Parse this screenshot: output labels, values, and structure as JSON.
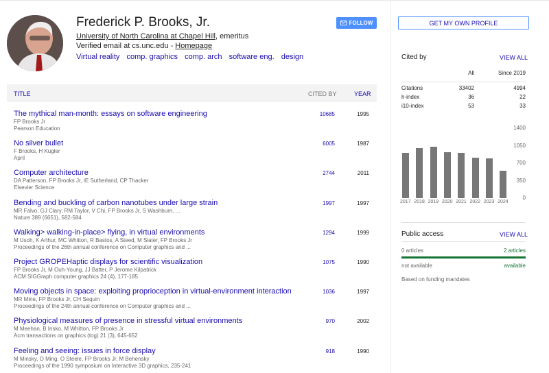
{
  "profile": {
    "name": "Frederick P. Brooks, Jr.",
    "affiliation_link": "University of North Carolina at Chapel Hill",
    "affiliation_suffix": ", emeritus",
    "verified": "Verified email at cs.unc.edu - ",
    "homepage": "Homepage",
    "interests": [
      "Virtual reality",
      "comp. graphics",
      "comp. arch",
      "software eng.",
      "design"
    ],
    "follow_label": "FOLLOW",
    "my_profile_label": "GET MY OWN PROFILE"
  },
  "table": {
    "headers": {
      "title": "TITLE",
      "cited_by": "CITED BY",
      "year": "YEAR"
    },
    "rows": [
      {
        "title": "The mythical man-month: essays on software engineering",
        "authors": "FP Brooks Jr",
        "pub": "Pearson Education",
        "cited": "10685",
        "year": "1995"
      },
      {
        "title": "No silver bullet",
        "authors": "F Brooks, H Kugler",
        "pub": "April",
        "cited": "6005",
        "year": "1987"
      },
      {
        "title": "Computer architecture",
        "authors": "DA Patterson, FP Brooks Jr, IE Sutherland, CP Thacker",
        "pub": "Elsevier Science",
        "cited": "2744",
        "year": "2011"
      },
      {
        "title": "Bending and buckling of carbon nanotubes under large strain",
        "authors": "MR Falvo, GJ Clary, RM Taylor, V Chi, FP Brooks Jr, S Washburn, ...",
        "pub": "Nature 389 (6651), 582-584",
        "cited": "1997",
        "year": "1997"
      },
      {
        "title": "Walking> walking-in-place> flying, in virtual environments",
        "authors": "M Usoh, K Arthur, MC Whitton, R Bastos, A Steed, M Slater, FP Brooks Jr",
        "pub": "Proceedings of the 26th annual conference on Computer graphics and ...",
        "cited": "1294",
        "year": "1999"
      },
      {
        "title": "Project GROPEHaptic displays for scientific visualization",
        "authors": "FP Brooks Jr, M Ouh-Young, JJ Batter, P Jerome Kilpatrick",
        "pub": "ACM SIGGraph computer graphics 24 (4), 177-185",
        "cited": "1075",
        "year": "1990"
      },
      {
        "title": "Moving objects in space: exploiting proprioception in virtual-environment interaction",
        "authors": "MR Mine, FP Brooks Jr, CH Sequin",
        "pub": "Proceedings of the 24th annual conference on Computer graphics and ...",
        "cited": "1036",
        "year": "1997"
      },
      {
        "title": "Physiological measures of presence in stressful virtual environments",
        "authors": "M Meehan, B Insko, M Whitton, FP Brooks Jr",
        "pub": "Acm transactions on graphics (tog) 21 (3), 645-652",
        "cited": "970",
        "year": "2002"
      },
      {
        "title": "Feeling and seeing: issues in force display",
        "authors": "M Minsky, O Ming, O Steele, FP Brooks Jr, M Behensky",
        "pub": "Proceedings of the 1990 symposium on Interactive 3D graphics, 235-241",
        "cited": "918",
        "year": "1990"
      }
    ]
  },
  "cited_by": {
    "title": "Cited by",
    "view_all": "VIEW ALL",
    "col_all": "All",
    "col_since": "Since 2019",
    "rows": [
      {
        "label": "Citations",
        "all": "33402",
        "since": "4994"
      },
      {
        "label": "h-index",
        "all": "36",
        "since": "22"
      },
      {
        "label": "i10-index",
        "all": "53",
        "since": "33"
      }
    ]
  },
  "chart_data": {
    "type": "bar",
    "categories": [
      "2017",
      "2018",
      "2019",
      "2020",
      "2021",
      "2022",
      "2023",
      "2024"
    ],
    "values": [
      910,
      1000,
      1035,
      915,
      910,
      815,
      800,
      545
    ],
    "yticks": [
      "1400",
      "1050",
      "700",
      "350",
      "0"
    ],
    "ylim": [
      0,
      1400
    ],
    "bar_color": "#777777"
  },
  "public_access": {
    "title": "Public access",
    "view_all": "VIEW ALL",
    "left_top": "0 articles",
    "right_top": "2 articles",
    "left_bottom": "not available",
    "right_bottom": "available",
    "note": "Based on funding mandates"
  }
}
